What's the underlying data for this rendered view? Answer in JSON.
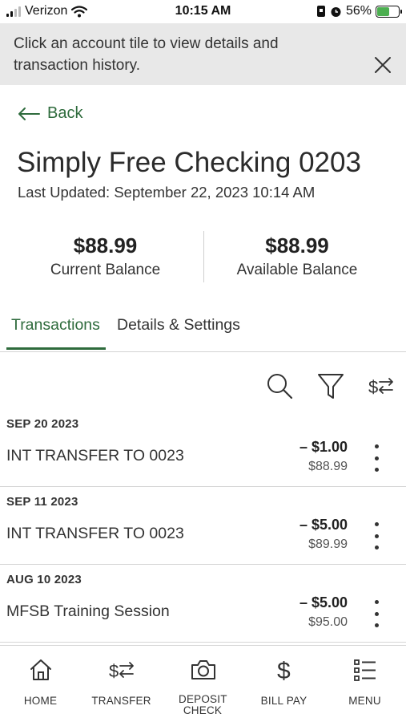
{
  "status_bar": {
    "carrier": "Verizon",
    "time": "10:15 AM",
    "battery_percent": "56%",
    "battery_level": 0.56
  },
  "banner": {
    "message": "Click an account tile to view details and transaction history."
  },
  "nav": {
    "back_label": "Back"
  },
  "account": {
    "title": "Simply Free Checking 0203",
    "last_updated": "Last Updated: September 22, 2023 10:14 AM",
    "current_balance": "$88.99",
    "current_balance_label": "Current Balance",
    "available_balance": "$88.99",
    "available_balance_label": "Available Balance"
  },
  "tabs": [
    {
      "label": "Transactions",
      "active": true
    },
    {
      "label": "Details & Settings",
      "active": false
    }
  ],
  "toolbar": {
    "icons": [
      "search-icon",
      "filter-icon",
      "sort-icon"
    ]
  },
  "transactions": [
    {
      "date": "SEP 20 2023",
      "description": "INT TRANSFER TO 0023",
      "amount": "– $1.00",
      "balance": "$88.99"
    },
    {
      "date": "SEP 11 2023",
      "description": "INT TRANSFER TO 0023",
      "amount": "– $5.00",
      "balance": "$89.99"
    },
    {
      "date": "AUG 10 2023",
      "description": "MFSB Training Session",
      "amount": "– $5.00",
      "balance": "$95.00"
    }
  ],
  "bottom_nav": [
    {
      "label": "HOME",
      "icon": "home-icon"
    },
    {
      "label": "TRANSFER",
      "icon": "transfer-icon"
    },
    {
      "label": "DEPOSIT CHECK",
      "icon": "camera-icon"
    },
    {
      "label": "BILL PAY",
      "icon": "dollar-icon"
    },
    {
      "label": "MENU",
      "icon": "menu-list-icon"
    }
  ],
  "colors": {
    "accent": "#2e6b3c",
    "banner_bg": "#e8e8e8",
    "divider": "#d6d6d6"
  }
}
